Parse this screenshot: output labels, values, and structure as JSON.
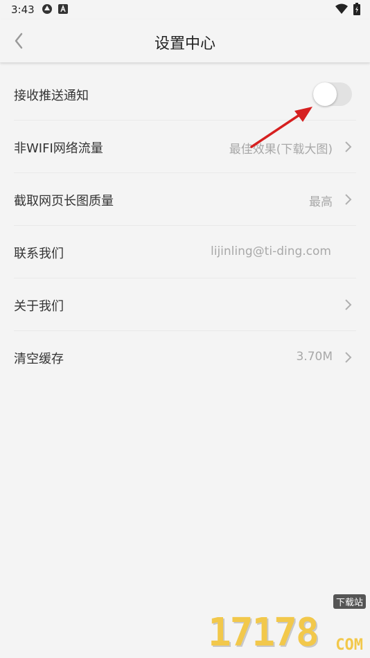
{
  "status_bar": {
    "time": "3:43"
  },
  "header": {
    "title": "设置中心"
  },
  "settings": [
    {
      "label": "接收推送通知",
      "type": "toggle",
      "enabled": false
    },
    {
      "label": "非WIFI网络流量",
      "value": "最佳效果(下载大图)",
      "chevron": true
    },
    {
      "label": "截取网页长图质量",
      "value": "最高",
      "chevron": true
    },
    {
      "label": "联系我们",
      "value": "lijinling@ti-ding.com",
      "chevron": false
    },
    {
      "label": "关于我们",
      "value": "",
      "chevron": true
    },
    {
      "label": "清空缓存",
      "value": "3.70M",
      "chevron": true
    }
  ],
  "watermark": {
    "number": "17178",
    "badge": "下载站",
    "domain": "COM"
  },
  "colors": {
    "background": "#f4f4f4",
    "annotation_arrow": "#d62020",
    "toggle_off": "#e2e2e2"
  }
}
